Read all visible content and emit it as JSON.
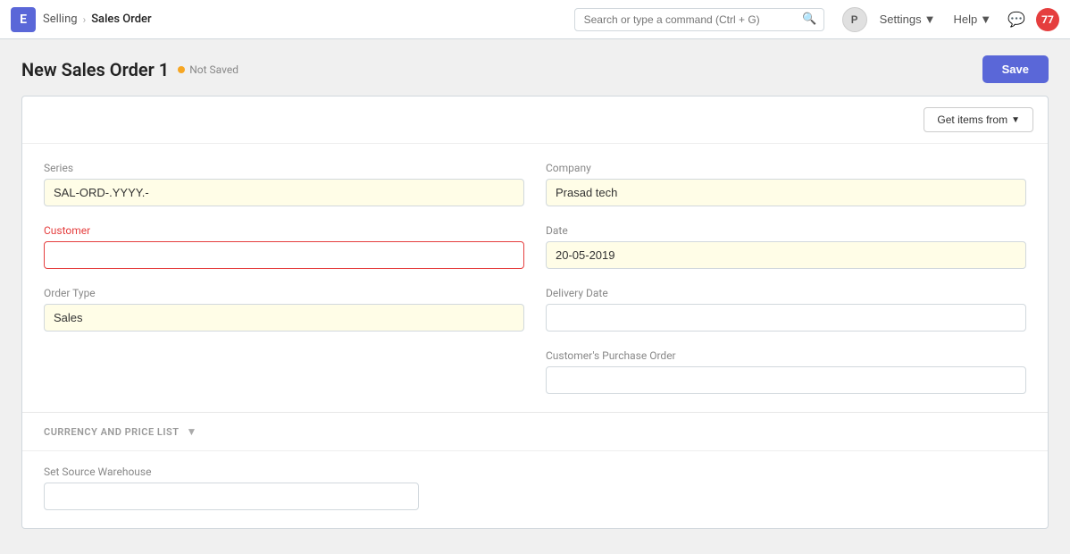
{
  "navbar": {
    "brand_letter": "E",
    "breadcrumb_parent": "Selling",
    "breadcrumb_current": "Sales Order",
    "search_placeholder": "Search or type a command (Ctrl + G)",
    "avatar_label": "P",
    "settings_label": "Settings",
    "help_label": "Help",
    "notification_count": "77"
  },
  "page": {
    "title": "New Sales Order 1",
    "status": "Not Saved",
    "save_button": "Save"
  },
  "form": {
    "get_items_button": "Get items from",
    "series_label": "Series",
    "series_value": "SAL-ORD-.YYYY.-",
    "company_label": "Company",
    "company_value": "Prasad tech",
    "customer_label": "Customer",
    "customer_value": "",
    "date_label": "Date",
    "date_value": "20-05-2019",
    "order_type_label": "Order Type",
    "order_type_value": "Sales",
    "delivery_date_label": "Delivery Date",
    "delivery_date_value": "",
    "purchase_order_label": "Customer's Purchase Order",
    "purchase_order_value": ""
  },
  "currency_section": {
    "label": "CURRENCY AND PRICE LIST"
  },
  "warehouse_section": {
    "label": "Set Source Warehouse",
    "value": ""
  }
}
